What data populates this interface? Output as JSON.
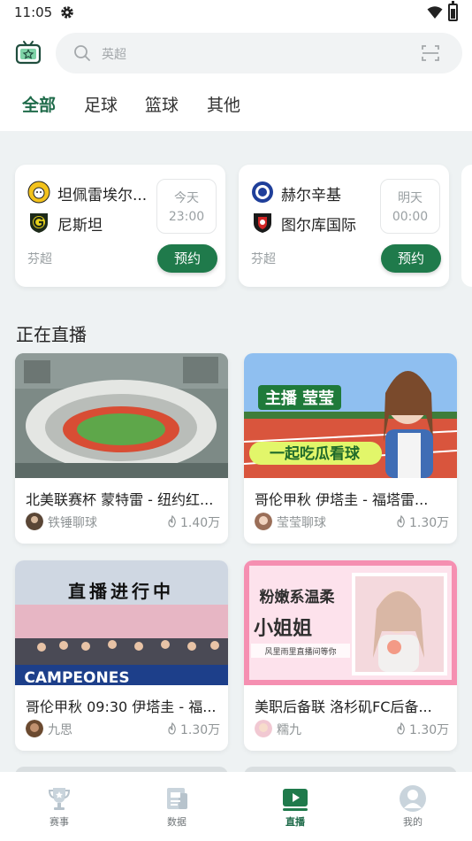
{
  "status": {
    "time": "11:05"
  },
  "search": {
    "placeholder": "英超"
  },
  "tabs": [
    "全部",
    "足球",
    "篮球",
    "其他"
  ],
  "matches": [
    {
      "home": "坦佩雷埃尔...",
      "away": "尼斯坦",
      "day": "今天",
      "time": "23:00",
      "league": "芬超",
      "action": "预约"
    },
    {
      "home": "赫尔辛基",
      "away": "图尔库国际",
      "day": "明天",
      "time": "00:00",
      "league": "芬超",
      "action": "预约"
    }
  ],
  "live": {
    "title": "正在直播",
    "items": [
      {
        "title": "北美联赛杯 蒙特雷 - 纽约红...",
        "anchor": "铁锤聊球",
        "heat": "1.40万",
        "thumb_text": ""
      },
      {
        "title": "哥伦甲秋 伊塔圭 - 福塔雷...",
        "anchor": "莹莹聊球",
        "heat": "1.30万",
        "thumb_text": "主播 莹莹",
        "thumb_text2": "一起吃瓜看球"
      },
      {
        "title": "哥伦甲秋 09:30 伊塔圭 - 福...",
        "anchor": "九思",
        "heat": "1.30万",
        "thumb_text": "直播进行中",
        "thumb_text2": "CAMPEONES"
      },
      {
        "title": "美职后备联 洛杉矶FC后备...",
        "anchor": "糯九",
        "heat": "1.30万",
        "thumb_text": "粉嫩系温柔",
        "thumb_text2": "小姐姐",
        "thumb_text3": "风里雨里直播间等你"
      }
    ]
  },
  "nav": [
    {
      "label": "赛事",
      "icon": "trophy-icon"
    },
    {
      "label": "数据",
      "icon": "data-icon"
    },
    {
      "label": "直播",
      "icon": "live-icon"
    },
    {
      "label": "我的",
      "icon": "profile-icon"
    }
  ],
  "colors": {
    "accent": "#1f7a4b",
    "accent_text": "#1f6b4a",
    "background": "#eef2f3"
  }
}
